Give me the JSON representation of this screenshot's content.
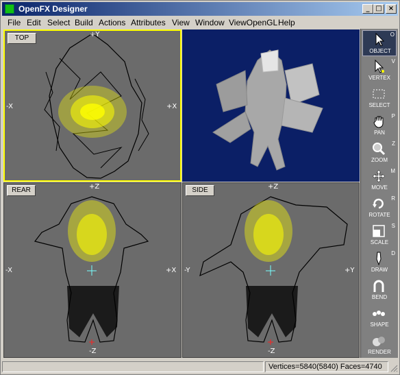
{
  "window": {
    "title": "OpenFX Designer"
  },
  "menu": [
    "File",
    "Edit",
    "Select",
    "Build",
    "Actions",
    "Attributes",
    "View",
    "Window",
    "ViewOpenGL",
    "Help"
  ],
  "viewports": {
    "top": {
      "label": "TOP",
      "axes": {
        "up": "+Y",
        "left": "-X",
        "right": "+X"
      }
    },
    "rear": {
      "label": "REAR",
      "axes": {
        "up": "+Z",
        "down": "-Z",
        "left": "-X",
        "right": "+X"
      }
    },
    "side": {
      "label": "SIDE",
      "axes": {
        "up": "+Z",
        "down": "-Z",
        "left": "-Y",
        "right": "+Y"
      }
    }
  },
  "tools": [
    {
      "label": "OBJECT",
      "key": "O",
      "icon": "arrow-cursor-icon"
    },
    {
      "label": "VERTEX",
      "key": "V",
      "icon": "vertex-cursor-icon"
    },
    {
      "label": "SELECT",
      "key": "",
      "icon": "select-box-icon"
    },
    {
      "label": "PAN",
      "key": "P",
      "icon": "hand-icon"
    },
    {
      "label": "ZOOM",
      "key": "Z",
      "icon": "magnifier-icon"
    },
    {
      "label": "MOVE",
      "key": "M",
      "icon": "move-arrows-icon"
    },
    {
      "label": "ROTATE",
      "key": "R",
      "icon": "rotate-icon"
    },
    {
      "label": "SCALE",
      "key": "S",
      "icon": "scale-icon"
    },
    {
      "label": "DRAW",
      "key": "D",
      "icon": "pen-icon"
    },
    {
      "label": "BEND",
      "key": "",
      "icon": "bend-icon"
    },
    {
      "label": "SHAPE",
      "key": "",
      "icon": "shape-icon"
    },
    {
      "label": "RENDER",
      "key": "",
      "icon": "render-spheres-icon"
    }
  ],
  "status": {
    "left": "",
    "counts": "Vertices=5840(5840) Faces=4740"
  },
  "colors": {
    "viewport_bg": "#6b6b6b",
    "gl_bg": "#0b1f66",
    "wire": "#000000",
    "selected_vertex": "#ffff00",
    "active_border": "#ffff00"
  }
}
